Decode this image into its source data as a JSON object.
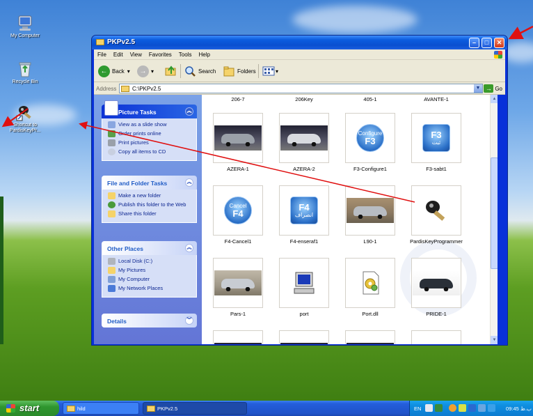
{
  "desktop": {
    "icons": [
      {
        "label": "My Computer"
      },
      {
        "label": "Recycle Bin"
      },
      {
        "label": "Shortcut to PardisKeyPr..."
      }
    ]
  },
  "window": {
    "title": "PKPv2.5",
    "menu": [
      "File",
      "Edit",
      "View",
      "Favorites",
      "Tools",
      "Help"
    ],
    "toolbar": {
      "back": "Back",
      "search": "Search",
      "folders": "Folders"
    },
    "address": {
      "label": "Address",
      "value": "C:\\PKPv2.5",
      "go": "Go"
    }
  },
  "taskpane": {
    "picture_tasks": {
      "title": "Picture Tasks",
      "items": [
        "View as a slide show",
        "Order prints online",
        "Print pictures",
        "Copy all items to CD"
      ]
    },
    "file_folder_tasks": {
      "title": "File and Folder Tasks",
      "items": [
        "Make a new folder",
        "Publish this folder to the Web",
        "Share this folder"
      ]
    },
    "other_places": {
      "title": "Other Places",
      "items": [
        "Local Disk (C:)",
        "My Pictures",
        "My Computer",
        "My Network Places"
      ]
    },
    "details": {
      "title": "Details"
    }
  },
  "content": {
    "top_labels": [
      "206-7",
      "206Key",
      "405-1",
      "AVANTE-1"
    ],
    "items": [
      {
        "caption": "AZERA-1"
      },
      {
        "caption": "AZERA-2"
      },
      {
        "caption": "F3-Configure1",
        "tile_line1": "Configure",
        "tile_line2": "F3"
      },
      {
        "caption": "F3-sabt1",
        "tile_big": "F3",
        "tile_small": "ثبت"
      },
      {
        "caption": "F4-Cancel1",
        "tile_line1": "Cancel",
        "tile_line2": "F4"
      },
      {
        "caption": "F4-enseraf1",
        "tile_big": "F4",
        "tile_small": "انصراف"
      },
      {
        "caption": "L90-1"
      },
      {
        "caption": "PardisKeyProgrammer"
      },
      {
        "caption": "Pars-1"
      },
      {
        "caption": "port"
      },
      {
        "caption": "Port.dll"
      },
      {
        "caption": "PRIDE-1"
      }
    ]
  },
  "taskbar": {
    "start": "start",
    "buttons": [
      "hild",
      "PKPv2.5"
    ],
    "tray": {
      "lang": "EN",
      "clock": "09:45 ب.ظ"
    }
  },
  "colors": {
    "annotation_arrow": "#e01010",
    "title_blue": "#0a4fd0",
    "start_green": "#2f962f"
  }
}
